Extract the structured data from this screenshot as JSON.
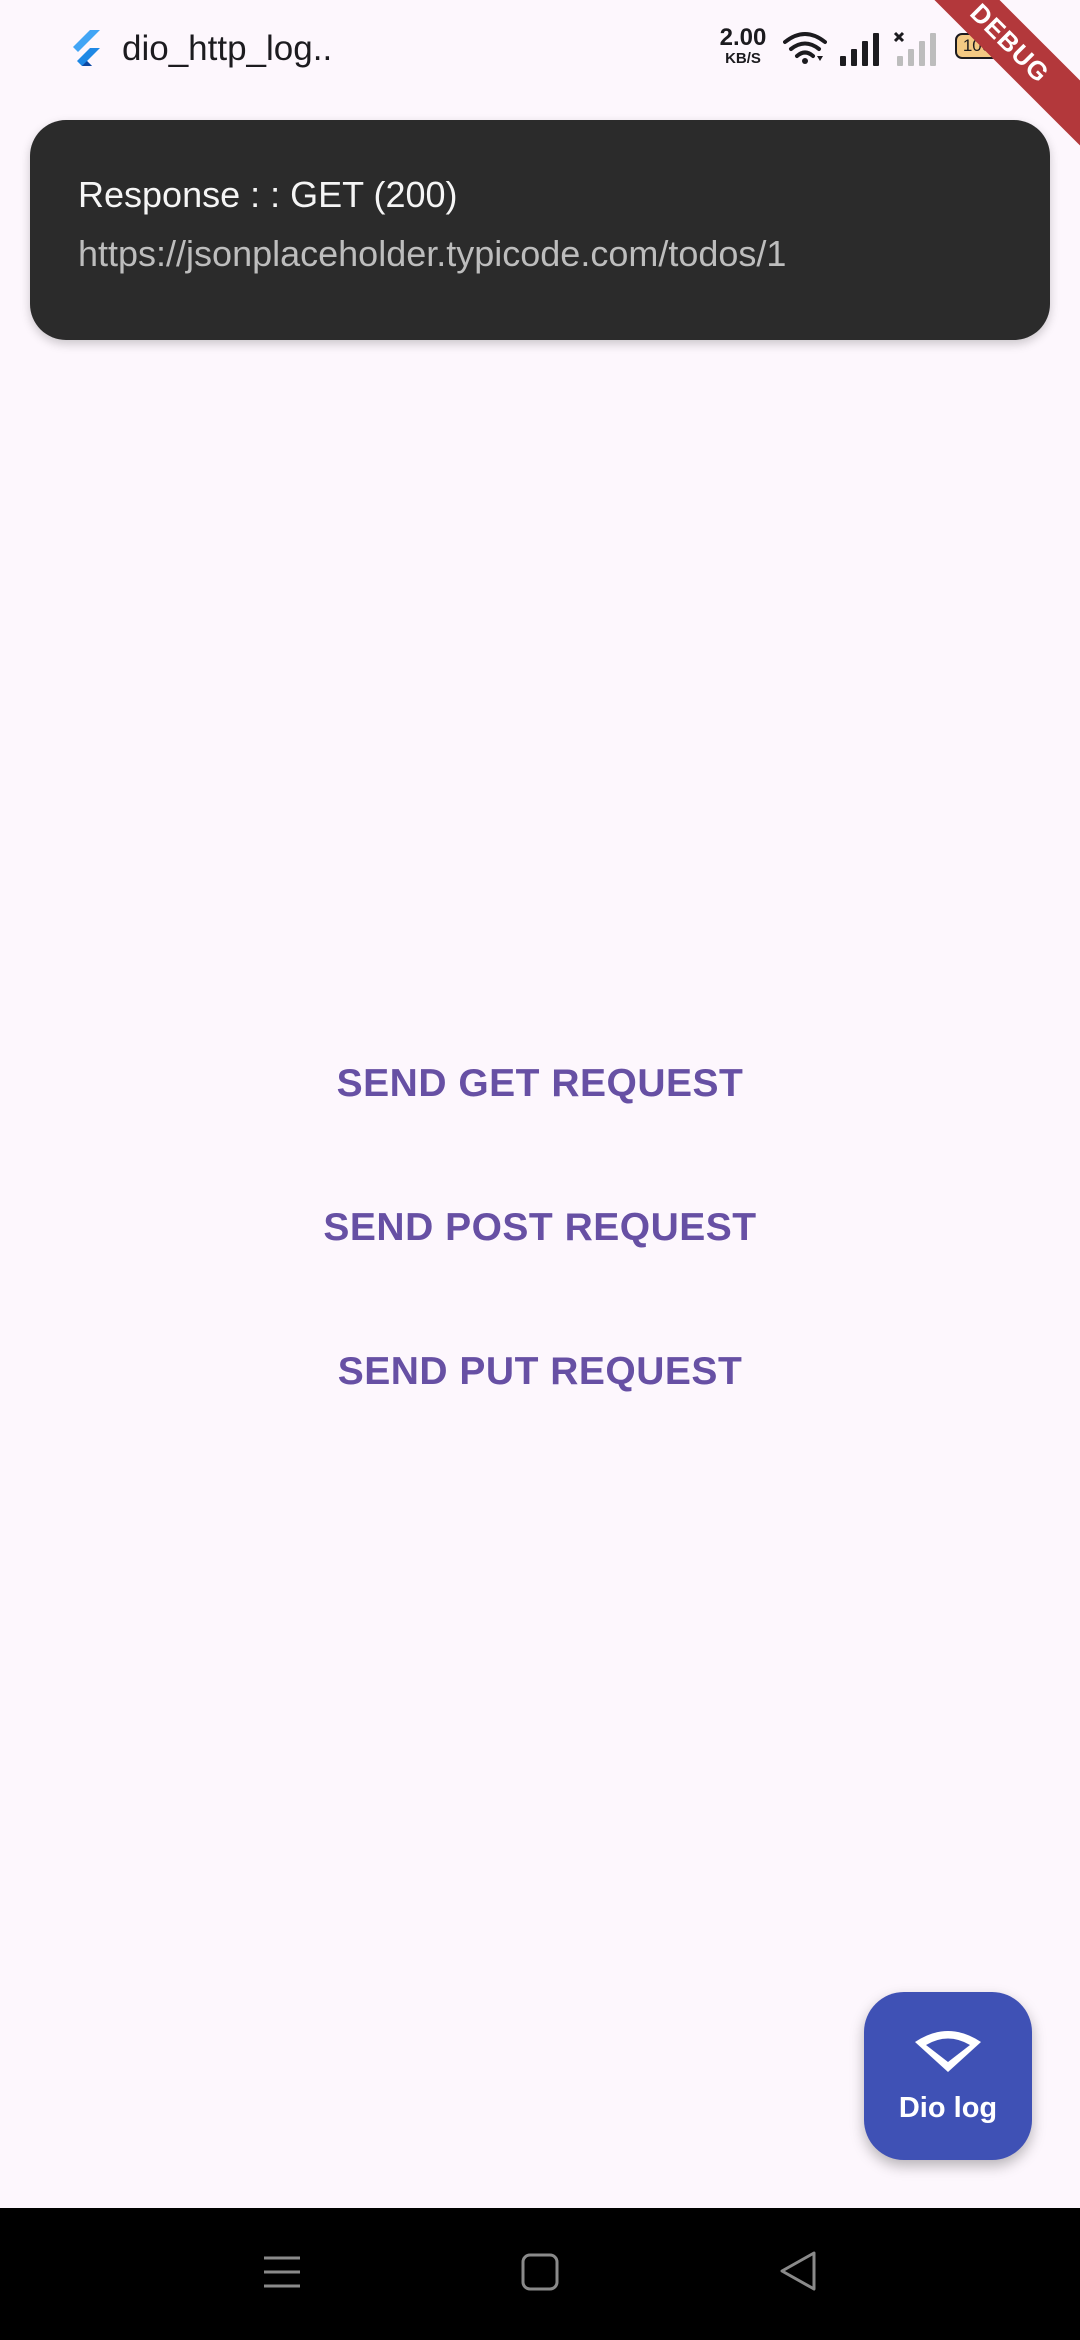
{
  "status_bar": {
    "app_title": "dio_http_log..",
    "net_speed_value": "2.00",
    "net_speed_unit": "KB/S",
    "battery_level": "100",
    "debug_banner": "DEBUG"
  },
  "toast": {
    "title": "Response : : GET (200)",
    "url": "https://jsonplaceholder.typicode.com/todos/1"
  },
  "buttons": {
    "get": "SEND GET REQUEST",
    "post": "SEND POST REQUEST",
    "put": "SEND PUT REQUEST"
  },
  "fab": {
    "label": "Dio log",
    "icon": "wifi-icon"
  },
  "nav_bar": {
    "icons": [
      "menu-icon",
      "home-icon",
      "back-icon"
    ]
  },
  "colors": {
    "background": "#fdf7fd",
    "button_text": "#6750a4",
    "fab": "#3f51b5",
    "toast_bg": "#2b2b2b",
    "debug_banner": "#b3383b"
  }
}
